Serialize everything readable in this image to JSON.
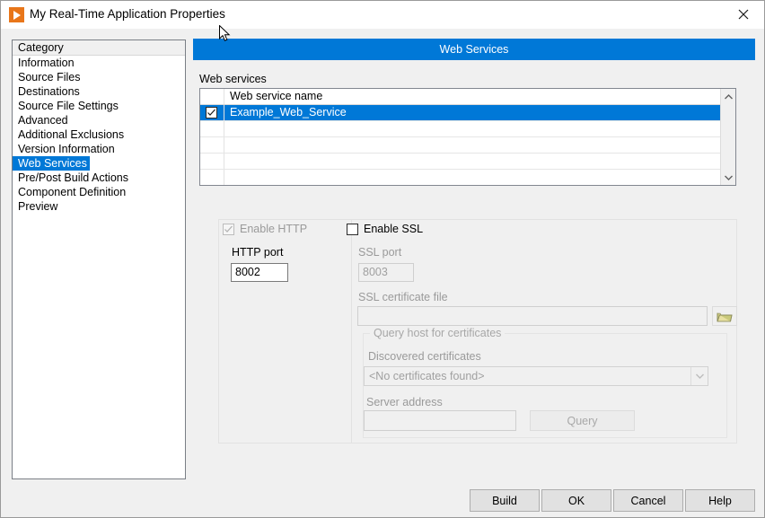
{
  "window": {
    "title": "My Real-Time Application Properties",
    "app_icon": "play-triangle-icon",
    "close_icon": "close-icon"
  },
  "sidebar": {
    "header": "Category",
    "selected": "Web Services",
    "items": [
      {
        "label": "Information"
      },
      {
        "label": "Source Files"
      },
      {
        "label": "Destinations"
      },
      {
        "label": "Source File Settings"
      },
      {
        "label": "Advanced"
      },
      {
        "label": "Additional Exclusions"
      },
      {
        "label": "Version Information"
      },
      {
        "label": "Web Services"
      },
      {
        "label": "Pre/Post Build Actions"
      },
      {
        "label": "Component Definition"
      },
      {
        "label": "Preview"
      }
    ]
  },
  "banner": {
    "title": "Web Services",
    "color": "#0078d7"
  },
  "web_services": {
    "group_label": "Web services",
    "column_header": "Web service name",
    "rows": [
      {
        "checked": true,
        "name": "Example_Web_Service",
        "selected": true
      },
      {
        "checked": false,
        "name": "",
        "selected": false
      },
      {
        "checked": false,
        "name": "",
        "selected": false
      },
      {
        "checked": false,
        "name": "",
        "selected": false
      },
      {
        "checked": false,
        "name": "",
        "selected": false
      }
    ],
    "scroll_up_icon": "chevron-up-icon",
    "scroll_down_icon": "chevron-down-icon"
  },
  "settings": {
    "http": {
      "enable_label": "Enable HTTP",
      "enable_checked": true,
      "enable_disabled": true,
      "port_label": "HTTP port",
      "port_value": "8002",
      "port_disabled": false
    },
    "ssl": {
      "enable_label": "Enable SSL",
      "enable_checked": false,
      "enable_disabled": false,
      "port_label": "SSL port",
      "port_value": "8003",
      "port_disabled": true,
      "cert_file_label": "SSL certificate file",
      "cert_file_value": "",
      "browse_icon": "folder-open-icon",
      "query_group_label": "Query host for certificates",
      "discovered_label": "Discovered certificates",
      "discovered_value": "<No certificates found>",
      "discovered_arrow_icon": "chevron-down-icon",
      "server_address_label": "Server address",
      "server_address_value": "",
      "query_button_label": "Query"
    }
  },
  "footer": {
    "build_label": "Build",
    "ok_label": "OK",
    "cancel_label": "Cancel",
    "help_label": "Help"
  },
  "cursor": {
    "icon": "mouse-pointer-icon"
  }
}
